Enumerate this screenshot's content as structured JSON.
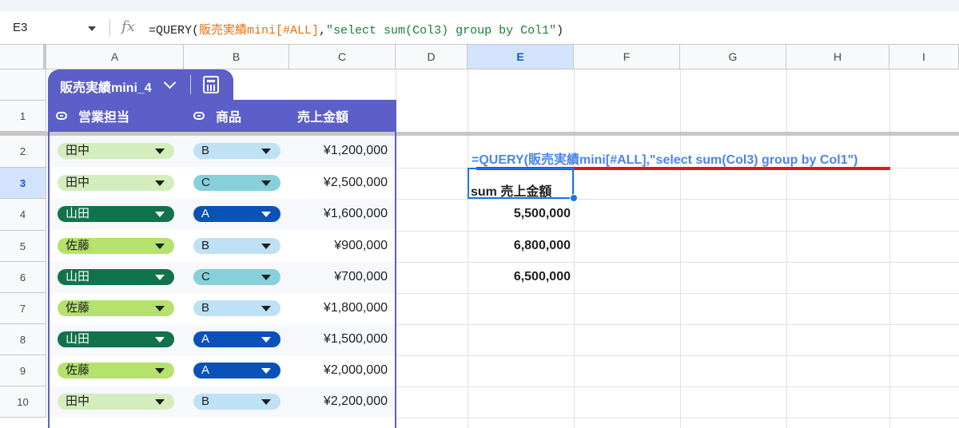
{
  "formula_bar": {
    "cell_ref": "E3",
    "fx_label": "fx",
    "formula_prefix": "=QUERY(",
    "formula_range": "販売実績mini[#ALL]",
    "formula_comma": ",",
    "formula_string": "\"select sum(Col3) group by Col1\"",
    "formula_close": ")"
  },
  "columns": [
    "A",
    "B",
    "C",
    "D",
    "E",
    "F",
    "G",
    "H",
    "I"
  ],
  "selected_column": "E",
  "rows": [
    "1",
    "2",
    "3",
    "4",
    "5",
    "6",
    "7",
    "8",
    "9",
    "10"
  ],
  "selected_row": "3",
  "table": {
    "name": "販売実績mini_4",
    "headers": [
      "営業担当",
      "商品",
      "売上金額"
    ],
    "records": [
      {
        "person": "田中",
        "product": "B",
        "amount": "¥1,200,000"
      },
      {
        "person": "田中",
        "product": "C",
        "amount": "¥2,500,000"
      },
      {
        "person": "山田",
        "product": "A",
        "amount": "¥1,600,000"
      },
      {
        "person": "佐藤",
        "product": "B",
        "amount": "¥900,000"
      },
      {
        "person": "山田",
        "product": "C",
        "amount": "¥700,000"
      },
      {
        "person": "佐藤",
        "product": "B",
        "amount": "¥1,800,000"
      },
      {
        "person": "山田",
        "product": "A",
        "amount": "¥1,500,000"
      },
      {
        "person": "佐藤",
        "product": "A",
        "amount": "¥2,000,000"
      },
      {
        "person": "田中",
        "product": "B",
        "amount": "¥2,200,000"
      }
    ]
  },
  "chip_colors": {
    "田中": {
      "bg": "#d4edbc",
      "fg": "#1f1f1f"
    },
    "山田": {
      "bg": "#11734b",
      "fg": "#ffffff"
    },
    "佐藤": {
      "bg": "#b5e26c",
      "fg": "#1f1f1f"
    },
    "A": {
      "bg": "#0b52b8",
      "fg": "#ffffff"
    },
    "B": {
      "bg": "#bfe1f6",
      "fg": "#1f1f1f"
    },
    "C": {
      "bg": "#86d0dc",
      "fg": "#1f1f1f"
    }
  },
  "query": {
    "formula_text": "=QUERY(販売実績mini[#ALL],\"select sum(Col3) group by Col1\")",
    "header": "sum 売上金額",
    "results": [
      "5,500,000",
      "6,800,000",
      "6,500,000"
    ]
  }
}
